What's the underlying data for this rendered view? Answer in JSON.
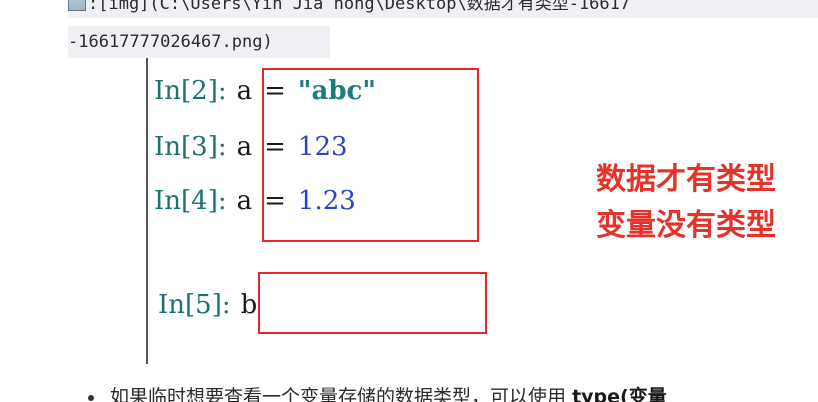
{
  "markdown": {
    "line1": ":[img](C:\\Users\\Yin Jia hong\\Desktop\\数据才有类型-16617",
    "line2": "-16617777026467.png)"
  },
  "code": {
    "lines": [
      {
        "prompt": "In[2]:",
        "var": "a",
        "op": "=",
        "value": "\"abc\""
      },
      {
        "prompt": "In[3]:",
        "var": "a",
        "op": "=",
        "value": "123"
      },
      {
        "prompt": "In[4]:",
        "var": "a",
        "op": "=",
        "value": "1.23"
      }
    ],
    "line5": {
      "prompt": "In[5]:",
      "var": "b"
    }
  },
  "notes": {
    "line1": "数据才有类型",
    "line2": "变量没有类型"
  },
  "bullet": {
    "text": "如果临时想要查看一个变量存储的数据类型，可以使用",
    "code": "type(变量"
  },
  "colors": {
    "annotation_red": "#e32626",
    "number_blue": "#2b43c9",
    "string_teal": "#1f7a7a"
  }
}
